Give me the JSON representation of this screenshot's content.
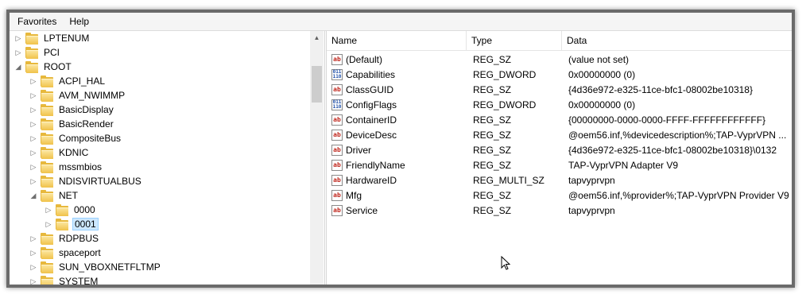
{
  "menubar": {
    "items": [
      "Favorites",
      "Help"
    ]
  },
  "tree": {
    "items": [
      {
        "label": "LPTENUM",
        "expander": "▷"
      },
      {
        "label": "PCI",
        "expander": "▷"
      },
      {
        "label": "ROOT",
        "expander": "◢"
      },
      {
        "label": "ACPI_HAL",
        "expander": "▷"
      },
      {
        "label": "AVM_NWIMMP",
        "expander": "▷"
      },
      {
        "label": "BasicDisplay",
        "expander": "▷"
      },
      {
        "label": "BasicRender",
        "expander": "▷"
      },
      {
        "label": "CompositeBus",
        "expander": "▷"
      },
      {
        "label": "KDNIC",
        "expander": "▷"
      },
      {
        "label": "mssmbios",
        "expander": "▷"
      },
      {
        "label": "NDISVIRTUALBUS",
        "expander": "▷"
      },
      {
        "label": "NET",
        "expander": "◢"
      },
      {
        "label": "0000",
        "expander": "▷"
      },
      {
        "label": "0001",
        "expander": "▷"
      },
      {
        "label": "RDPBUS",
        "expander": "▷"
      },
      {
        "label": "spaceport",
        "expander": "▷"
      },
      {
        "label": "SUN_VBOXNETFLTMP",
        "expander": "▷"
      },
      {
        "label": "SYSTEM",
        "expander": "▷"
      }
    ]
  },
  "list": {
    "headers": {
      "name": "Name",
      "type": "Type",
      "data": "Data"
    },
    "rows": [
      {
        "icon": "ab",
        "name": "(Default)",
        "type": "REG_SZ",
        "data": "(value not set)"
      },
      {
        "icon": "bin",
        "name": "Capabilities",
        "type": "REG_DWORD",
        "data": "0x00000000 (0)"
      },
      {
        "icon": "ab",
        "name": "ClassGUID",
        "type": "REG_SZ",
        "data": "{4d36e972-e325-11ce-bfc1-08002be10318}"
      },
      {
        "icon": "bin",
        "name": "ConfigFlags",
        "type": "REG_DWORD",
        "data": "0x00000000 (0)"
      },
      {
        "icon": "ab",
        "name": "ContainerID",
        "type": "REG_SZ",
        "data": "{00000000-0000-0000-FFFF-FFFFFFFFFFFF}"
      },
      {
        "icon": "ab",
        "name": "DeviceDesc",
        "type": "REG_SZ",
        "data": "@oem56.inf,%devicedescription%;TAP-VyprVPN ..."
      },
      {
        "icon": "ab",
        "name": "Driver",
        "type": "REG_SZ",
        "data": "{4d36e972-e325-11ce-bfc1-08002be10318}\\0132"
      },
      {
        "icon": "ab",
        "name": "FriendlyName",
        "type": "REG_SZ",
        "data": "TAP-VyprVPN Adapter V9"
      },
      {
        "icon": "ab",
        "name": "HardwareID",
        "type": "REG_MULTI_SZ",
        "data": "tapvyprvpn"
      },
      {
        "icon": "ab",
        "name": "Mfg",
        "type": "REG_SZ",
        "data": "@oem56.inf,%provider%;TAP-VyprVPN Provider V9"
      },
      {
        "icon": "ab",
        "name": "Service",
        "type": "REG_SZ",
        "data": "tapvyprvpn"
      }
    ]
  },
  "icons": {
    "string_value": "ab",
    "binary_value": "011 110"
  }
}
